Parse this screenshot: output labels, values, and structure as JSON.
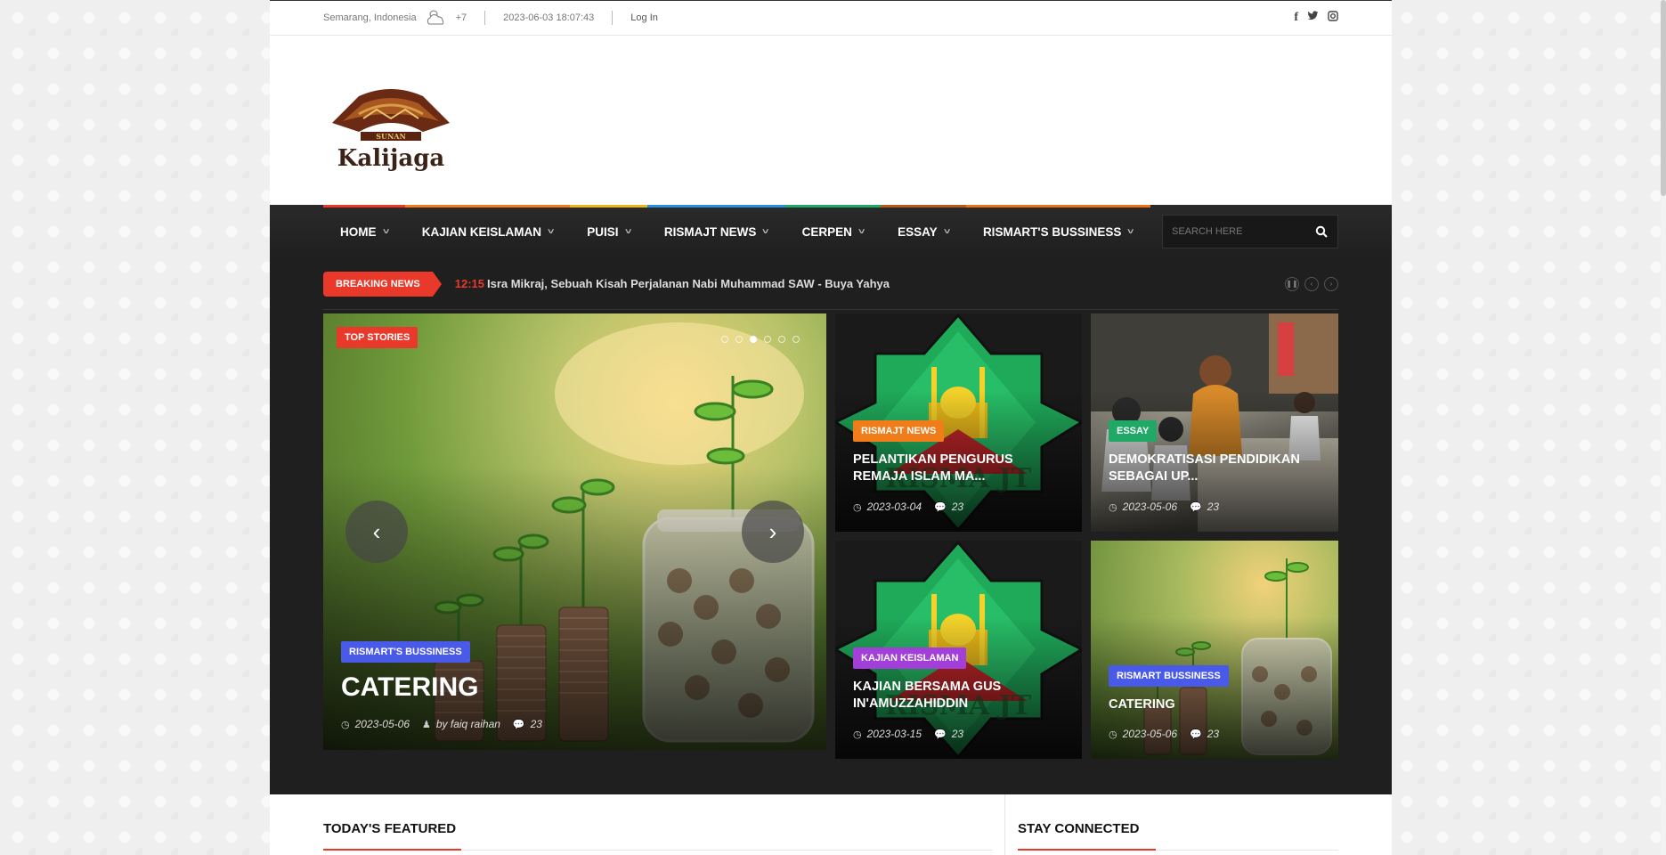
{
  "topbar": {
    "location": "Semarang, Indonesia",
    "temperature": "+7",
    "datetime": "2023-06-03 18:07:43",
    "login": "Log In",
    "social": [
      "f",
      "t",
      "ig"
    ]
  },
  "header": {
    "logo_text": "Kalijaga",
    "logo_subtext": "SUNAN"
  },
  "nav": {
    "items": [
      {
        "label": "HOME",
        "color": "#e8392a"
      },
      {
        "label": "KAJIAN KEISLAMAN",
        "color": "#f07c1a"
      },
      {
        "label": "PUISI",
        "color": "#e8b81a"
      },
      {
        "label": "RISMAJT NEWS",
        "color": "#2a8fd8"
      },
      {
        "label": "CERPEN",
        "color": "#1fa866"
      },
      {
        "label": "ESSAY",
        "color": "#b25b1f"
      },
      {
        "label": "RISMART'S BUSSINESS",
        "color": "#e8731a"
      }
    ],
    "search_placeholder": "SEARCH HERE"
  },
  "breaking": {
    "label": "BREAKING NEWS",
    "time": "12:15",
    "headline": "Isra Mikraj, Sebuah Kisah Perjalanan Nabi Muhammad SAW - Buya Yahya"
  },
  "slider": {
    "badge": "TOP STORIES",
    "category": "RISMART'S BUSSINESS",
    "category_color": "#4a5ae8",
    "title": "CATERING",
    "date": "2023-05-06",
    "author": "by faiq raihan",
    "comments": "23"
  },
  "cards": [
    {
      "category": "RISMAJT NEWS",
      "category_color": "#f07c1a",
      "title": "PELANTIKAN PENGURUS REMAJA ISLAM MA...",
      "date": "2023-03-04",
      "comments": "23"
    },
    {
      "category": "ESSAY",
      "category_color": "#1fa866",
      "title": "DEMOKRATISASI PENDIDIKAN SEBAGAI UP...",
      "date": "2023-05-06",
      "comments": "23"
    },
    {
      "category": "KAJIAN KEISLAMAN",
      "category_color": "#a23fd8",
      "title": "KAJIAN BERSAMA GUS IN'AMUZZAHIDDIN",
      "date": "2023-03-15",
      "comments": "23"
    },
    {
      "category": "RISMART BUSSINESS",
      "category_color": "#4a5ae8",
      "title": "CATERING",
      "date": "2023-05-06",
      "comments": "23"
    }
  ],
  "sections": {
    "featured": "TODAY'S FEATURED",
    "connected": "STAY CONNECTED"
  }
}
